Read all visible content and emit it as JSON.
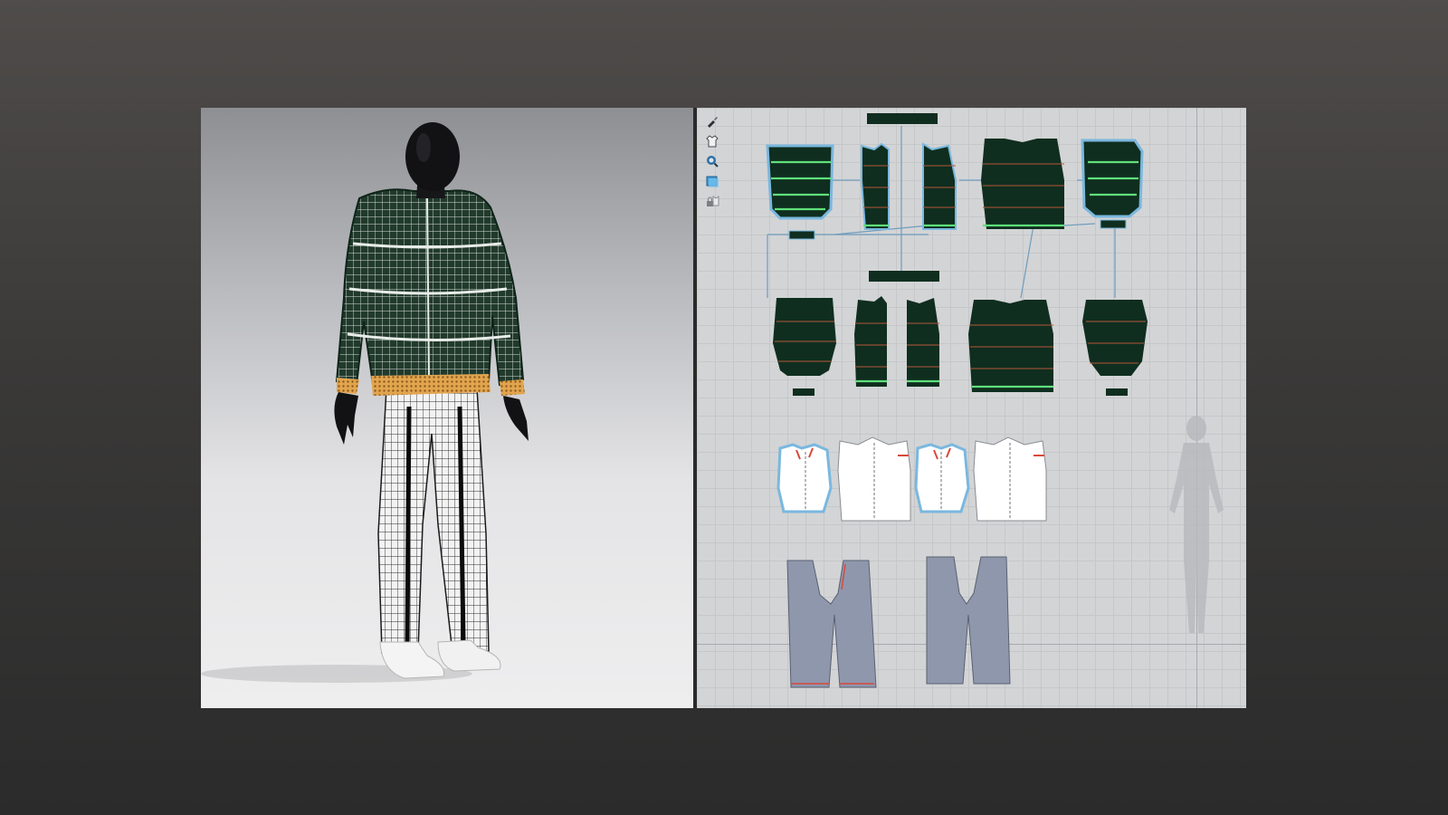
{
  "window": {
    "width": 1600,
    "height": 900
  },
  "viewport_3d": {
    "label": "",
    "background_top": "#8e8f93",
    "background_bottom": "#eeeeef"
  },
  "viewport_2d": {
    "label": "",
    "background": "#d3d4d6",
    "grid_color": "#c6c7c9"
  },
  "toolbar": {
    "tools": [
      {
        "icon": "brush-icon"
      },
      {
        "icon": "garment-icon"
      },
      {
        "icon": "search-icon"
      },
      {
        "icon": "texture-icon"
      },
      {
        "icon": "lock-icon"
      }
    ]
  },
  "colors": {
    "padded_jacket": "#0f2e1f",
    "seam_line": "#5fe07a",
    "stitch_line": "#b4553a",
    "selected_outline": "#7ab8de",
    "lining": "#ffffff",
    "pants": "#8f97ad",
    "rib_cuff": "#e2a54e",
    "avatar": "#121214"
  }
}
